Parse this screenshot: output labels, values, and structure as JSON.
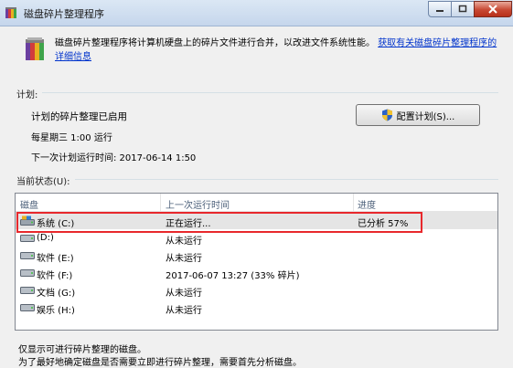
{
  "window": {
    "title": "磁盘碎片整理程序",
    "controls": {
      "minimize": "minimize",
      "maximize": "maximize",
      "close": "close"
    }
  },
  "intro": {
    "text": "磁盘碎片整理程序将计算机硬盘上的碎片文件进行合并，以改进文件系统性能。",
    "link": "获取有关磁盘碎片整理程序的详细信息"
  },
  "schedule": {
    "label": "计划:",
    "status": "计划的碎片整理已启用",
    "frequency": "每星期三 1:00 运行",
    "next_run": "下一次计划运行时间: 2017-06-14 1:50",
    "configure_button": "配置计划(S)..."
  },
  "current_status": {
    "label": "当前状态(U):",
    "columns": [
      "磁盘",
      "上一次运行时间",
      "进度"
    ],
    "rows": [
      {
        "disk": "系统 (C:)",
        "last_run": "正在运行...",
        "progress": "已分析 57%",
        "icon": "system-drive-icon",
        "selected": true
      },
      {
        "disk": "(D:)",
        "last_run": "从未运行",
        "progress": "",
        "icon": "drive-icon",
        "selected": false
      },
      {
        "disk": "软件 (E:)",
        "last_run": "从未运行",
        "progress": "",
        "icon": "drive-icon",
        "selected": false
      },
      {
        "disk": "软件 (F:)",
        "last_run": "2017-06-07 13:27 (33% 碎片)",
        "progress": "",
        "icon": "drive-icon",
        "selected": false
      },
      {
        "disk": "文档 (G:)",
        "last_run": "从未运行",
        "progress": "",
        "icon": "drive-icon",
        "selected": false
      },
      {
        "disk": "娱乐 (H:)",
        "last_run": "从未运行",
        "progress": "",
        "icon": "drive-icon",
        "selected": false
      }
    ]
  },
  "footer": {
    "line1": "仅显示可进行碎片整理的磁盘。",
    "line2": "为了最好地确定磁盘是否需要立即进行碎片整理，需要首先分析磁盘。"
  },
  "colors": {
    "highlight": "#e8282c",
    "link": "#0033cc",
    "selected_row": "#e5e5e5"
  }
}
